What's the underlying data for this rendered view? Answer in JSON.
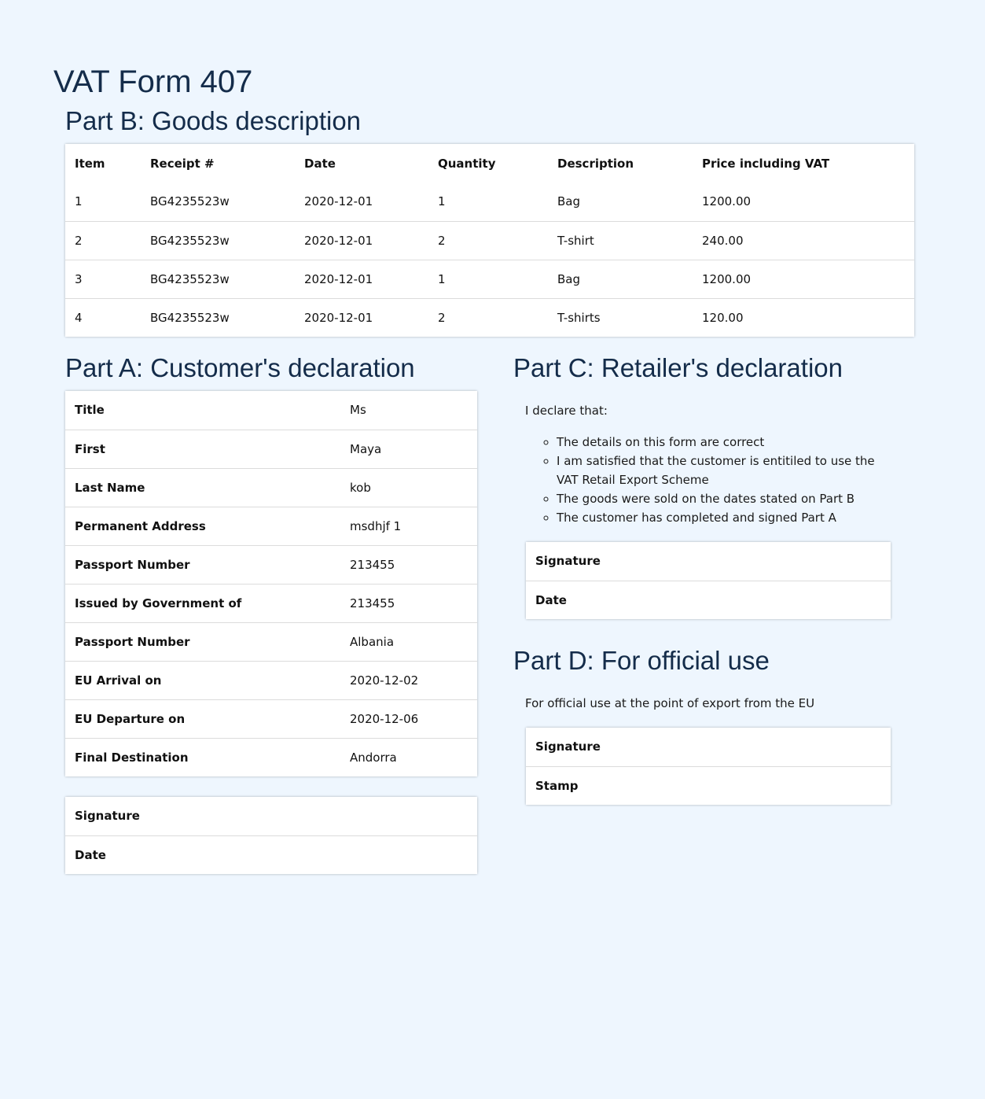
{
  "page_title": "VAT Form 407",
  "part_b": {
    "heading": "Part B: Goods description",
    "columns": [
      "Item",
      "Receipt #",
      "Date",
      "Quantity",
      "Description",
      "Price including VAT"
    ],
    "rows": [
      [
        "1",
        "BG4235523w",
        "2020-12-01",
        "1",
        "Bag",
        "1200.00"
      ],
      [
        "2",
        "BG4235523w",
        "2020-12-01",
        "2",
        "T-shirt",
        "240.00"
      ],
      [
        "3",
        "BG4235523w",
        "2020-12-01",
        "1",
        "Bag",
        "1200.00"
      ],
      [
        "4",
        "BG4235523w",
        "2020-12-01",
        "2",
        "T-shirts",
        "120.00"
      ]
    ]
  },
  "part_a": {
    "heading": "Part A: Customer's declaration",
    "fields": [
      {
        "label": "Title",
        "value": "Ms"
      },
      {
        "label": "First",
        "value": "Maya"
      },
      {
        "label": "Last Name",
        "value": "kob"
      },
      {
        "label": "Permanent Address",
        "value": "msdhjf 1"
      },
      {
        "label": "Passport Number",
        "value": "213455"
      },
      {
        "label": "Issued by Government of",
        "value": "213455"
      },
      {
        "label": "Passport Number",
        "value": "Albania"
      },
      {
        "label": "EU Arrival on",
        "value": "2020-12-02"
      },
      {
        "label": "EU Departure on",
        "value": "2020-12-06"
      },
      {
        "label": "Final Destination",
        "value": "Andorra"
      }
    ],
    "signature_label": "Signature",
    "date_label": "Date"
  },
  "part_c": {
    "heading": "Part C: Retailer's declaration",
    "intro": "I declare that:",
    "items": [
      "The details on this form are correct",
      "I am satisfied that the customer is entitiled to use the VAT Retail Export Scheme",
      "The goods were sold on the dates stated on Part B",
      "The customer has completed and signed Part A"
    ],
    "signature_label": "Signature",
    "date_label": "Date"
  },
  "part_d": {
    "heading": "Part D: For official use",
    "intro": "For official use at the point of export from the EU",
    "signature_label": "Signature",
    "stamp_label": "Stamp"
  }
}
